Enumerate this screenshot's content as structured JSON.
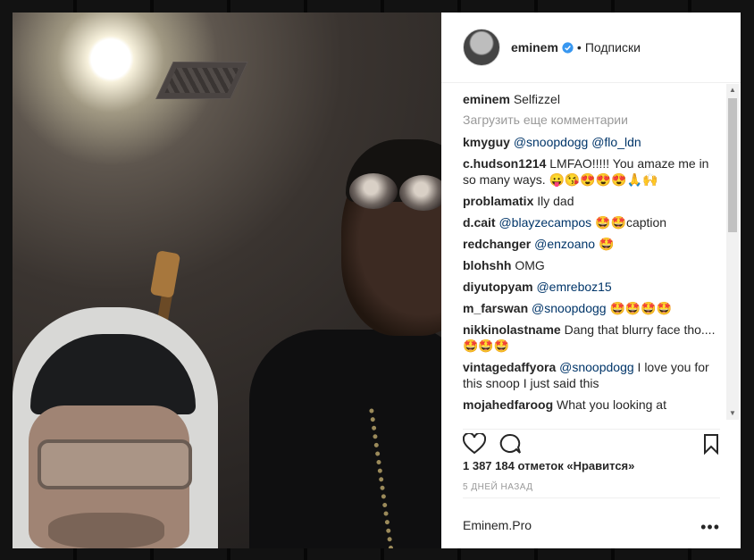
{
  "post": {
    "username": "eminem",
    "separator": "•",
    "follow_label": "Подписки",
    "caption_user": "eminem",
    "caption_text": "Selfizzel",
    "load_more": "Загрузить еще комментарии",
    "likes_text": "1 387 184 отметок «Нравится»",
    "time_ago": "5 ДНЕЙ НАЗАД",
    "footer_label": "Eminem.Pro",
    "more_label": "•••"
  },
  "comments": [
    {
      "user": "kmyguy",
      "text": "",
      "mentions": "@snoopdogg @flo_ldn",
      "emoji": ""
    },
    {
      "user": "c.hudson1214",
      "text": "LMFAO!!!!! You amaze me in so many ways.",
      "mentions": "",
      "emoji": "😛😘😍😍😍🙏🙌"
    },
    {
      "user": "problamatix",
      "text": "Ily dad",
      "mentions": "",
      "emoji": ""
    },
    {
      "user": "d.cait",
      "text": "caption",
      "mentions": "@blayzecampos",
      "emoji": "🤩🤩"
    },
    {
      "user": "redchanger",
      "text": "",
      "mentions": "@enzoano",
      "emoji": "🤩"
    },
    {
      "user": "blohshh",
      "text": "OMG",
      "mentions": "",
      "emoji": ""
    },
    {
      "user": "diyutopyam",
      "text": "",
      "mentions": "@emreboz15",
      "emoji": ""
    },
    {
      "user": "m_farswan",
      "text": "",
      "mentions": "@snoopdogg",
      "emoji": "🤩🤩🤩🤩"
    },
    {
      "user": "nikkinolastname",
      "text": "Dang that blurry face tho....",
      "mentions": "",
      "emoji": "🤩🤩🤩"
    },
    {
      "user": "vintagedaffyora",
      "text": "I love you for this snoop I just said this",
      "mentions": "@snoopdogg",
      "emoji": ""
    },
    {
      "user": "mojahedfaroog",
      "text": "What you looking at",
      "mentions": "",
      "emoji": ""
    }
  ],
  "icons": {
    "like": "heart-icon",
    "comment": "comment-icon",
    "save": "bookmark-icon",
    "verified": "verified-badge-icon"
  },
  "colors": {
    "mention": "#003569",
    "verified": "#3897f0",
    "muted": "#999999"
  }
}
